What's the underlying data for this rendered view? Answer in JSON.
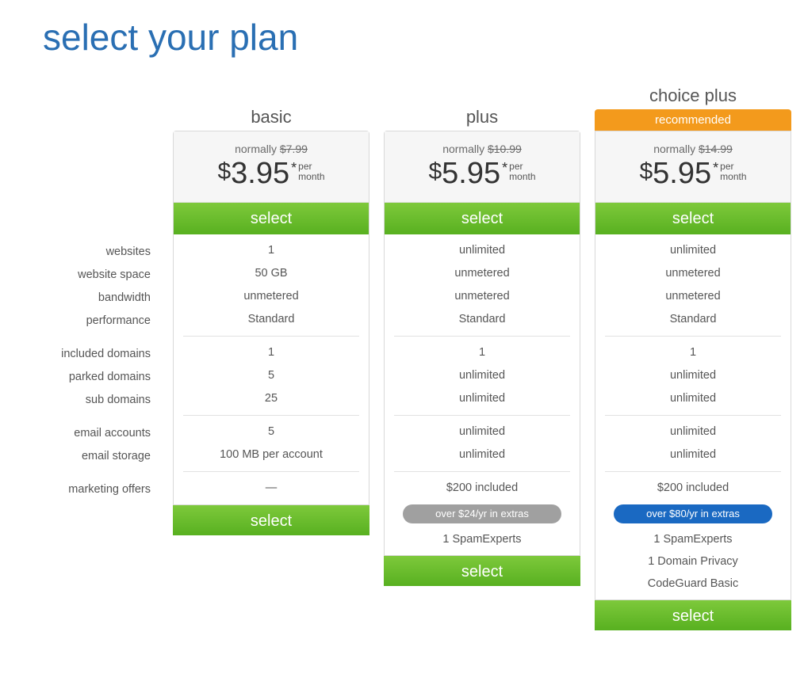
{
  "title": "select your plan",
  "select_label": "select",
  "recommended_label": "recommended",
  "normally_prefix": "normally ",
  "per_suffix_line1": "per",
  "per_suffix_line2": "month",
  "currency": "$",
  "asterisk": "*",
  "features": [
    "websites",
    "website space",
    "bandwidth",
    "performance",
    "included domains",
    "parked domains",
    "sub domains",
    "email accounts",
    "email storage",
    "marketing offers"
  ],
  "plans": [
    {
      "name": "basic",
      "recommended": false,
      "normal_price": "$7.99",
      "price": "3.95",
      "values": [
        "1",
        "50 GB",
        "unmetered",
        "Standard",
        "1",
        "5",
        "25",
        "5",
        "100 MB per account",
        "—"
      ],
      "extras_pill": null,
      "extras": []
    },
    {
      "name": "plus",
      "recommended": false,
      "normal_price": "$10.99",
      "price": "5.95",
      "values": [
        "unlimited",
        "unmetered",
        "unmetered",
        "Standard",
        "1",
        "unlimited",
        "unlimited",
        "unlimited",
        "unlimited",
        "$200 included"
      ],
      "extras_pill": "over $24/yr in extras",
      "extras_pill_color": "gray",
      "extras": [
        "1 SpamExperts"
      ]
    },
    {
      "name": "choice plus",
      "recommended": true,
      "normal_price": "$14.99",
      "price": "5.95",
      "values": [
        "unlimited",
        "unmetered",
        "unmetered",
        "Standard",
        "1",
        "unlimited",
        "unlimited",
        "unlimited",
        "unlimited",
        "$200 included"
      ],
      "extras_pill": "over $80/yr in extras",
      "extras_pill_color": "blue",
      "extras": [
        "1 SpamExperts",
        "1 Domain Privacy",
        "CodeGuard Basic"
      ]
    }
  ]
}
